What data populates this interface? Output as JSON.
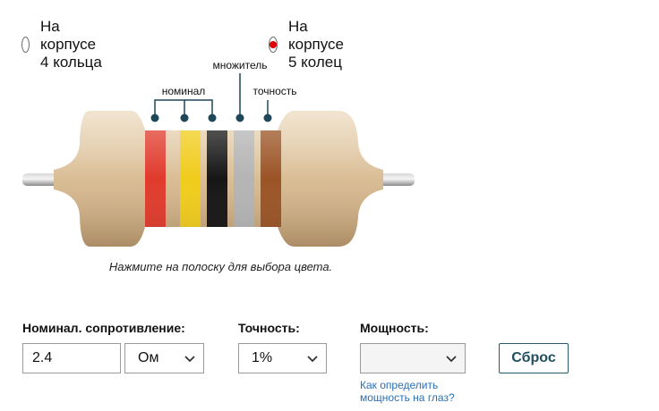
{
  "band_mode": {
    "options": [
      {
        "label": "На корпусе 4 кольца",
        "selected": false
      },
      {
        "label": "На корпусе 5 колец",
        "selected": true
      }
    ]
  },
  "resistor": {
    "labels": {
      "nominal": "номинал",
      "multiplier": "множитель",
      "tolerance": "точность"
    },
    "bands": [
      {
        "color": "#e03b2c",
        "role": "digit"
      },
      {
        "color": "#f0cc1c",
        "role": "digit"
      },
      {
        "color": "#161616",
        "role": "digit"
      },
      {
        "color": "#b4b4b4",
        "role": "multiplier"
      },
      {
        "color": "#9b5426",
        "role": "tolerance"
      }
    ]
  },
  "hint": "Нажмите на полоску для выбора цвета.",
  "form": {
    "resistance": {
      "label": "Номинал. сопротивление:",
      "value": "2.4",
      "unit": "Ом"
    },
    "tolerance": {
      "label": "Точность:",
      "value": "1%"
    },
    "power": {
      "label": "Мощность:",
      "value": ""
    },
    "help_link": "Как определить мощность на глаз?",
    "reset_label": "Сброс"
  }
}
